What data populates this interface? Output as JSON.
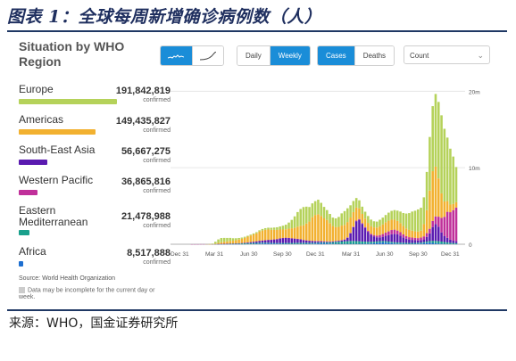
{
  "figure": {
    "title": "图表 1：全球每周新增确诊病例数（人）",
    "source": "来源：WHO，国金证券研究所"
  },
  "panel": {
    "title": "Situation by WHO Region",
    "period_buttons": [
      "Daily",
      "Weekly"
    ],
    "metric_buttons": [
      "Cases",
      "Deaths"
    ],
    "count_select": "Count",
    "source_note": "Source: World Health Organization",
    "disclaimer": "Data may be incomplete for the current day or week."
  },
  "regions": [
    {
      "name": "Europe",
      "total": "191,842,819",
      "unit": "confirmed",
      "color": "#b5d25a",
      "share": 1.0
    },
    {
      "name": "Americas",
      "total": "149,435,827",
      "unit": "confirmed",
      "color": "#f2b130",
      "share": 0.779
    },
    {
      "name": "South-East Asia",
      "total": "56,667,275",
      "unit": "confirmed",
      "color": "#5a1ab0",
      "share": 0.295
    },
    {
      "name": "Western Pacific",
      "total": "36,865,816",
      "unit": "confirmed",
      "color": "#c0309a",
      "share": 0.192
    },
    {
      "name": "Eastern Mediterranean",
      "total": "21,478,988",
      "unit": "confirmed",
      "color": "#19a08c",
      "share": 0.112
    },
    {
      "name": "Africa",
      "total": "8,517,888",
      "unit": "confirmed",
      "color": "#1e6fd0",
      "share": 0.044
    }
  ],
  "chart_data": {
    "type": "bar",
    "stacked": true,
    "x_tick_labels": [
      "Dec 31",
      "Mar 31",
      "Jun 30",
      "Sep 30",
      "Dec 31",
      "Mar 31",
      "Jun 30",
      "Sep 30",
      "Dec 31"
    ],
    "y_tick_labels": [
      "20m",
      "10m",
      "0"
    ],
    "ylim": [
      0,
      24000000
    ],
    "series_order": [
      "Africa",
      "Eastern Mediterranean",
      "South-East Asia",
      "Western Pacific",
      "Americas",
      "Europe"
    ],
    "weeks": [
      [
        0,
        0,
        0,
        0.002,
        0,
        0
      ],
      [
        0,
        0,
        0,
        0.003,
        0,
        0
      ],
      [
        0,
        0,
        0,
        0.005,
        0,
        0
      ],
      [
        0,
        0,
        0,
        0.01,
        0,
        0
      ],
      [
        0,
        0,
        0,
        0.01,
        0,
        0
      ],
      [
        0,
        0,
        0,
        0.005,
        0,
        0.002
      ],
      [
        0,
        0,
        0,
        0.005,
        0.001,
        0.01
      ],
      [
        0,
        0.003,
        0,
        0.005,
        0.01,
        0.06
      ],
      [
        0,
        0.01,
        0,
        0.005,
        0.06,
        0.25
      ],
      [
        0.001,
        0.02,
        0.003,
        0.005,
        0.15,
        0.45
      ],
      [
        0.002,
        0.03,
        0.005,
        0.005,
        0.22,
        0.55
      ],
      [
        0.003,
        0.04,
        0.008,
        0.005,
        0.27,
        0.5
      ],
      [
        0.004,
        0.05,
        0.012,
        0.006,
        0.3,
        0.45
      ],
      [
        0.005,
        0.06,
        0.016,
        0.006,
        0.34,
        0.4
      ],
      [
        0.007,
        0.06,
        0.022,
        0.006,
        0.36,
        0.33
      ],
      [
        0.009,
        0.07,
        0.03,
        0.006,
        0.4,
        0.27
      ],
      [
        0.012,
        0.08,
        0.04,
        0.006,
        0.48,
        0.2
      ],
      [
        0.015,
        0.09,
        0.05,
        0.006,
        0.55,
        0.16
      ],
      [
        0.02,
        0.1,
        0.07,
        0.006,
        0.65,
        0.13
      ],
      [
        0.03,
        0.11,
        0.09,
        0.007,
        0.75,
        0.12
      ],
      [
        0.04,
        0.12,
        0.12,
        0.008,
        0.85,
        0.12
      ],
      [
        0.05,
        0.12,
        0.15,
        0.01,
        0.95,
        0.13
      ],
      [
        0.06,
        0.12,
        0.19,
        0.01,
        1.05,
        0.15
      ],
      [
        0.08,
        0.12,
        0.23,
        0.011,
        1.2,
        0.18
      ],
      [
        0.1,
        0.11,
        0.27,
        0.012,
        1.3,
        0.2
      ],
      [
        0.11,
        0.1,
        0.31,
        0.012,
        1.35,
        0.22
      ],
      [
        0.11,
        0.09,
        0.36,
        0.012,
        1.35,
        0.24
      ],
      [
        0.1,
        0.08,
        0.4,
        0.011,
        1.3,
        0.26
      ],
      [
        0.09,
        0.08,
        0.45,
        0.011,
        1.25,
        0.3
      ],
      [
        0.08,
        0.08,
        0.5,
        0.011,
        1.2,
        0.35
      ],
      [
        0.07,
        0.09,
        0.6,
        0.011,
        1.15,
        0.4
      ],
      [
        0.06,
        0.1,
        0.65,
        0.012,
        1.1,
        0.5
      ],
      [
        0.05,
        0.11,
        0.68,
        0.012,
        1.1,
        0.6
      ],
      [
        0.04,
        0.12,
        0.66,
        0.013,
        1.2,
        0.8
      ],
      [
        0.04,
        0.13,
        0.6,
        0.014,
        1.3,
        1.1
      ],
      [
        0.04,
        0.14,
        0.55,
        0.015,
        1.4,
        1.5
      ],
      [
        0.04,
        0.15,
        0.5,
        0.016,
        1.6,
        1.9
      ],
      [
        0.04,
        0.15,
        0.45,
        0.018,
        1.75,
        2.2
      ],
      [
        0.05,
        0.14,
        0.35,
        0.02,
        1.9,
        2.4
      ],
      [
        0.06,
        0.13,
        0.3,
        0.022,
        2.2,
        2.2
      ],
      [
        0.07,
        0.12,
        0.25,
        0.025,
        2.5,
        1.9
      ],
      [
        0.08,
        0.11,
        0.22,
        0.03,
        3.1,
        1.8
      ],
      [
        0.09,
        0.1,
        0.2,
        0.04,
        3.4,
        1.8
      ],
      [
        0.12,
        0.1,
        0.15,
        0.05,
        3.5,
        1.9
      ],
      [
        0.14,
        0.1,
        0.12,
        0.05,
        3.3,
        1.7
      ],
      [
        0.13,
        0.11,
        0.1,
        0.04,
        3.0,
        1.5
      ],
      [
        0.11,
        0.13,
        0.09,
        0.035,
        2.8,
        1.3
      ],
      [
        0.09,
        0.16,
        0.08,
        0.03,
        2.4,
        1.2
      ],
      [
        0.07,
        0.2,
        0.08,
        0.03,
        2.0,
        1.1
      ],
      [
        0.06,
        0.25,
        0.09,
        0.03,
        1.8,
        1.15
      ],
      [
        0.05,
        0.28,
        0.11,
        0.03,
        1.8,
        1.3
      ],
      [
        0.05,
        0.3,
        0.15,
        0.035,
        1.9,
        1.6
      ],
      [
        0.05,
        0.32,
        0.22,
        0.04,
        1.9,
        1.8
      ],
      [
        0.05,
        0.35,
        0.45,
        0.05,
        2.0,
        1.8
      ],
      [
        0.05,
        0.38,
        1.0,
        0.06,
        2.0,
        1.6
      ],
      [
        0.05,
        0.38,
        1.8,
        0.07,
        1.9,
        1.45
      ],
      [
        0.05,
        0.36,
        2.6,
        0.08,
        1.7,
        1.25
      ],
      [
        0.06,
        0.33,
        2.8,
        0.1,
        1.4,
        1.05
      ],
      [
        0.06,
        0.3,
        2.3,
        0.1,
        1.2,
        0.95
      ],
      [
        0.07,
        0.27,
        1.8,
        0.11,
        1.1,
        0.9
      ],
      [
        0.08,
        0.24,
        1.3,
        0.12,
        1.05,
        0.9
      ],
      [
        0.1,
        0.22,
        0.9,
        0.15,
        1.0,
        0.85
      ],
      [
        0.13,
        0.2,
        0.7,
        0.17,
        1.0,
        0.8
      ],
      [
        0.17,
        0.19,
        0.55,
        0.22,
        1.05,
        0.78
      ],
      [
        0.22,
        0.18,
        0.5,
        0.3,
        1.15,
        0.85
      ],
      [
        0.24,
        0.18,
        0.55,
        0.36,
        1.25,
        0.9
      ],
      [
        0.22,
        0.18,
        0.7,
        0.42,
        1.35,
        0.95
      ],
      [
        0.18,
        0.17,
        0.85,
        0.48,
        1.4,
        1.05
      ],
      [
        0.14,
        0.17,
        1.0,
        0.55,
        1.35,
        1.15
      ],
      [
        0.1,
        0.16,
        1.1,
        0.55,
        1.3,
        1.25
      ],
      [
        0.08,
        0.16,
        1.05,
        0.5,
        1.25,
        1.35
      ],
      [
        0.07,
        0.15,
        0.9,
        0.45,
        1.2,
        1.5
      ],
      [
        0.06,
        0.14,
        0.7,
        0.38,
        1.1,
        1.7
      ],
      [
        0.05,
        0.13,
        0.55,
        0.33,
        1.0,
        1.95
      ],
      [
        0.05,
        0.12,
        0.45,
        0.3,
        0.95,
        2.2
      ],
      [
        0.05,
        0.12,
        0.4,
        0.3,
        0.9,
        2.5
      ],
      [
        0.06,
        0.12,
        0.35,
        0.3,
        0.85,
        2.7
      ],
      [
        0.07,
        0.13,
        0.3,
        0.3,
        0.85,
        2.9
      ],
      [
        0.09,
        0.13,
        0.3,
        0.35,
        0.9,
        3.0
      ],
      [
        0.14,
        0.14,
        0.35,
        0.4,
        1.6,
        3.5
      ],
      [
        0.2,
        0.15,
        0.6,
        0.5,
        3.0,
        5.0
      ],
      [
        0.22,
        0.2,
        1.0,
        0.6,
        5.0,
        7.0
      ],
      [
        0.18,
        0.27,
        1.8,
        0.8,
        6.5,
        8.5
      ],
      [
        0.14,
        0.3,
        2.2,
        1.0,
        6.5,
        9.5
      ],
      [
        0.1,
        0.3,
        1.9,
        1.3,
        5.0,
        10.0
      ],
      [
        0.07,
        0.28,
        1.2,
        1.9,
        3.2,
        10.2
      ],
      [
        0.05,
        0.24,
        0.8,
        2.5,
        2.0,
        9.5
      ],
      [
        0.04,
        0.2,
        0.6,
        3.4,
        1.4,
        8.3
      ],
      [
        0.03,
        0.16,
        0.4,
        3.6,
        1.0,
        7.3
      ],
      [
        0.03,
        0.13,
        0.3,
        4.0,
        0.8,
        6.2
      ],
      [
        0.02,
        0.12,
        0.25,
        4.4,
        0.7,
        4.6
      ]
    ]
  }
}
